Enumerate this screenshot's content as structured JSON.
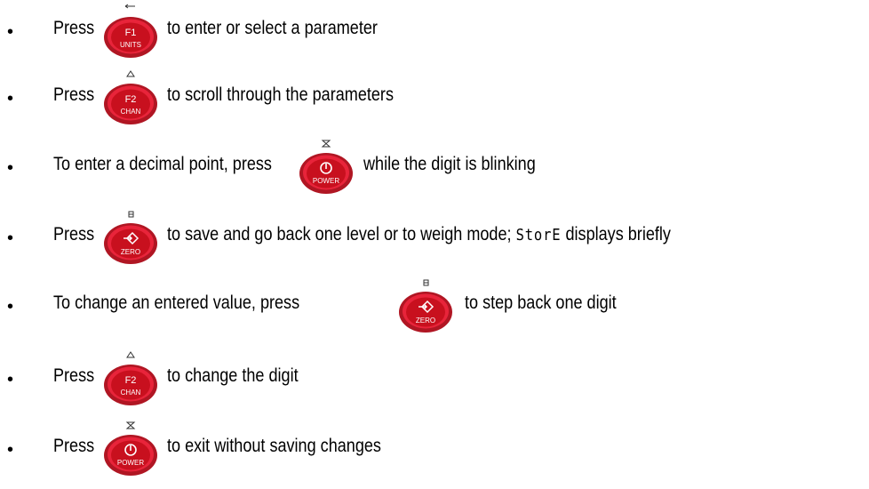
{
  "colors": {
    "key_outer": "#b01623",
    "key_rim": "#e8243a",
    "key_inner": "#c8101e",
    "text": "#000000"
  },
  "bullet": "•",
  "rows": [
    {
      "pre": "Press",
      "key": {
        "top_icon": "enter-arrow-icon",
        "main": "F1",
        "sub": "UNITS"
      },
      "post": "to enter or select a parameter"
    },
    {
      "pre": "Press",
      "key": {
        "top_icon": "triangle-up-icon",
        "main": "F2",
        "sub": "CHAN"
      },
      "post": "to scroll through the parameters"
    },
    {
      "pre": "To enter a decimal point, press",
      "key": {
        "top_icon": "hourglass-icon",
        "main": "power-icon",
        "sub": "POWER"
      },
      "post": "while the digit is blinking"
    },
    {
      "pre": "Press",
      "key": {
        "top_icon": "save-icon",
        "main": "zero-arrow-icon",
        "sub": "ZERO"
      },
      "post_a": "to save and go back one level or to weigh mode;",
      "post_seg": "StorE",
      "post_b": "displays briefly"
    },
    {
      "pre": "To change an entered value, press",
      "key": {
        "top_icon": "save-icon",
        "main": "zero-arrow-icon",
        "sub": "ZERO"
      },
      "post": "to step back one digit"
    },
    {
      "pre": "Press",
      "key": {
        "top_icon": "triangle-up-icon",
        "main": "F2",
        "sub": "CHAN"
      },
      "post": "to change the digit"
    },
    {
      "pre": "Press",
      "key": {
        "top_icon": "hourglass-icon",
        "main": "power-icon",
        "sub": "POWER"
      },
      "post": "to exit without saving changes"
    }
  ]
}
